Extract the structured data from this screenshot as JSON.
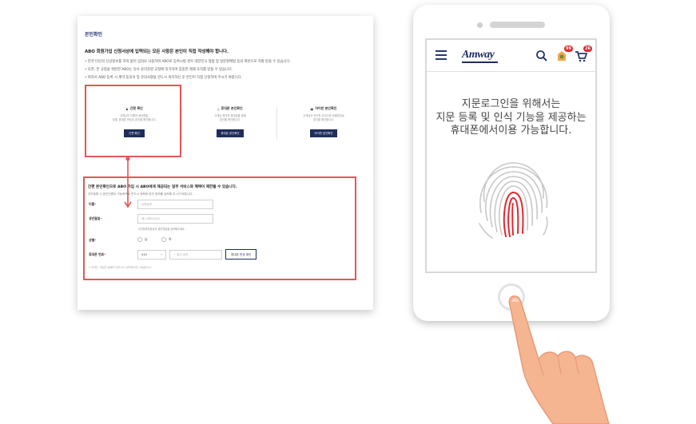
{
  "document": {
    "title": "본인확인",
    "heading": "ABO 회원가입 신청서상에 입력되는 모든 사항은 본인이 직접 작성해야 합니다.",
    "notes": [
      "• 만약 타인의 신상정보를 허락 없이 임의로 사용하여 ABO로 등록시킬 경우 대한민국 형법 및 방문판매법 등의 위반으로 처벌 받을 수 있습니다.",
      "• 또한, 본 규정을 위반한 ABO는 당사 윤리강령 규정에 의거하여 엄중한 제재 조치를 받을 수 있습니다.",
      "• 따라서 ABO 등록 시 계약 동의서 및 유의사항을 반드시 숙지하신 후 본인이 직접 신청하여 주시기 바랍니다."
    ],
    "options": [
      {
        "title": "간편 확인",
        "desc": [
          "고객님의 이름과 생년월일,",
          "성별, 휴대폰 번호로 본인을 확인합니다."
        ],
        "button": "간편 확인"
      },
      {
        "title": "휴대폰 본인확인",
        "desc": [
          "고객님 명의의 휴대폰을 통해",
          "본인을 확인합니다."
        ],
        "button": "휴대폰 본인확인"
      },
      {
        "title": "아이핀 본인확인",
        "desc": [
          "고객님의 아이핀 아이디와 비밀번호로",
          "본인을 확인합니다."
        ],
        "button": "아이핀 본인확인"
      }
    ],
    "form": {
      "heading": "간편 본인확인으로 ABO 가입 시 ABO에게 제공되는 일부 서비스와 혜택이 제한될 수 있습니다.",
      "subheading": "주민등록 시 본인인증이 가능하므로 반드시 정확한 본인 정보를 입력해 주시기 바랍니다.",
      "name_label": "이름",
      "name_placeholder": "실명입력",
      "birth_label": "생년월일",
      "birth_placeholder": "예) 19800320",
      "birth_hint": "주민등록번호상의 생년월일을 입력해주세요.",
      "gender_label": "성별",
      "gender_male": "남",
      "gender_female": "여",
      "phone_label": "휴대폰 번호",
      "phone_prefix": "010",
      "phone_placeholder": "'-' 없이 입력",
      "phone_button": "휴대폰 번호 확인",
      "footnote": "* 외국인 가입은 암웨이 비즈니스 센터에서만 가능합니다."
    }
  },
  "phone": {
    "logo": "Amway",
    "wishlist_count": "99",
    "cart_count": "26",
    "message_lines": [
      "지문로그인을 위해서는",
      "지문 등록 및 인식 기능을 제공하는",
      "휴대폰에서이용 가능합니다."
    ]
  },
  "colors": {
    "accent_red": "#e25757",
    "navy": "#1f2d5c",
    "fingerprint_red": "#e0282e"
  }
}
